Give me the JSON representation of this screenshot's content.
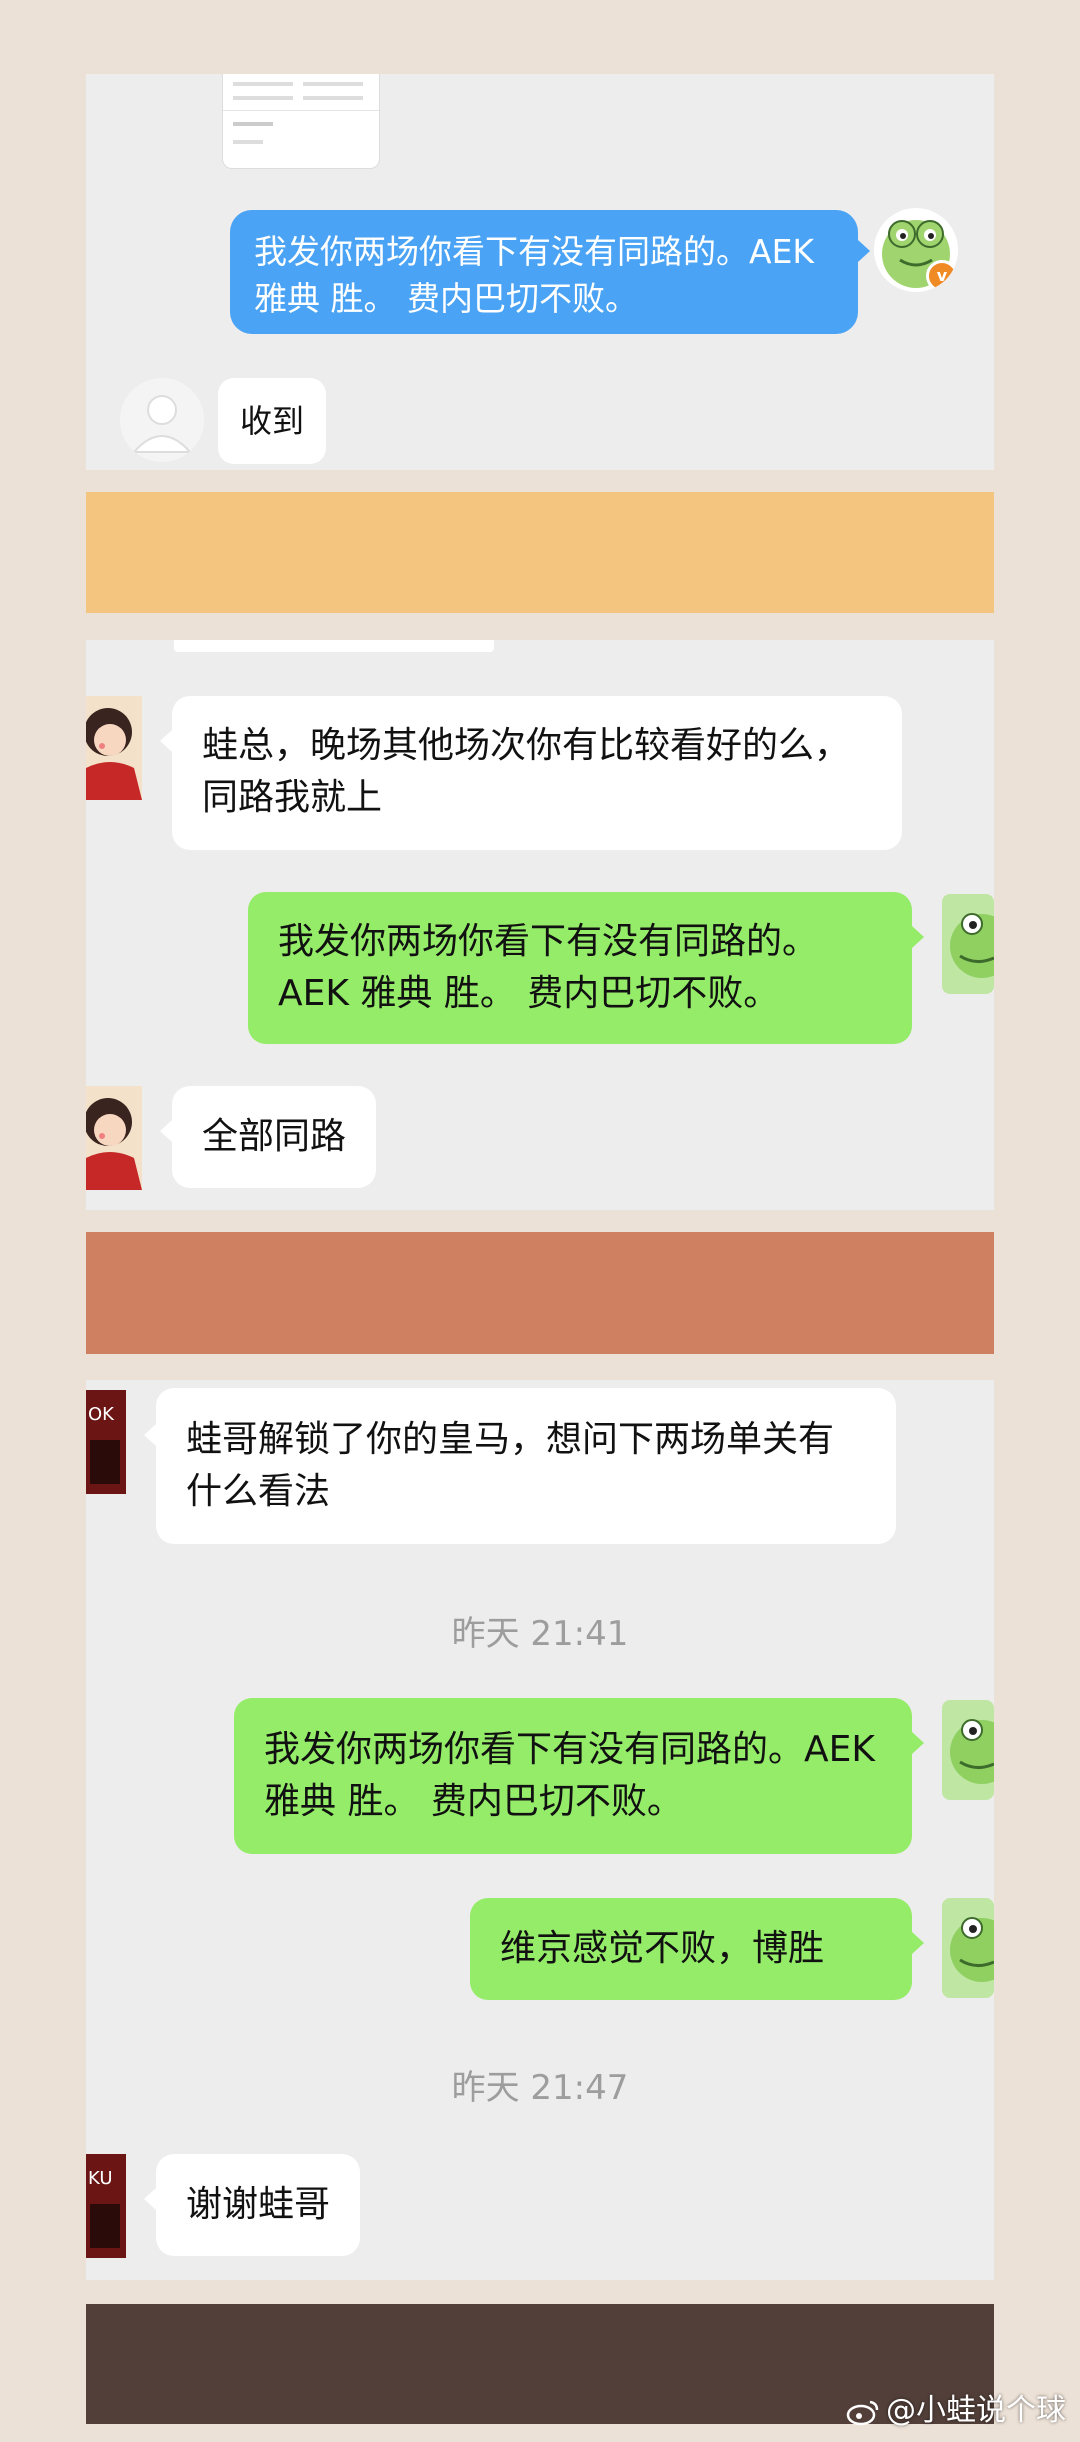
{
  "panel1": {
    "messages": [
      {
        "text": "我发你两场你看下有没有同路的。AEK 雅典  胜。 费内巴切不败。",
        "side": "right"
      },
      {
        "text": "收到",
        "side": "left"
      }
    ]
  },
  "panel2": {
    "messages": [
      {
        "text": "蛙总，晚场其他场次你有比较看好的么，同路我就上",
        "side": "left"
      },
      {
        "text": "我发你两场你看下有没有同路的。AEK 雅典  胜。 费内巴切不败。",
        "side": "right"
      },
      {
        "text": "全部同路",
        "side": "left"
      }
    ]
  },
  "panel3": {
    "messages": [
      {
        "text": "蛙哥解锁了你的皇马，想问下两场单关有什么看法",
        "side": "left"
      },
      {
        "timestamp": "昨天 21:41"
      },
      {
        "text": "我发你两场你看下有没有同路的。AEK 雅典  胜。 费内巴切不败。",
        "side": "right"
      },
      {
        "text": "维京感觉不败，博胜",
        "side": "right"
      },
      {
        "timestamp": "昨天 21:47"
      },
      {
        "text": "谢谢蛙哥",
        "side": "left"
      }
    ]
  },
  "watermark": "@小蛙说个球",
  "colors": {
    "page_bg": "#ece1d6",
    "band_yellow": "#f3c57e",
    "band_orange": "#cf8061",
    "band_brown": "#523f39",
    "bubble_green": "#95ec69",
    "bubble_blue": "#4aa3f4"
  }
}
